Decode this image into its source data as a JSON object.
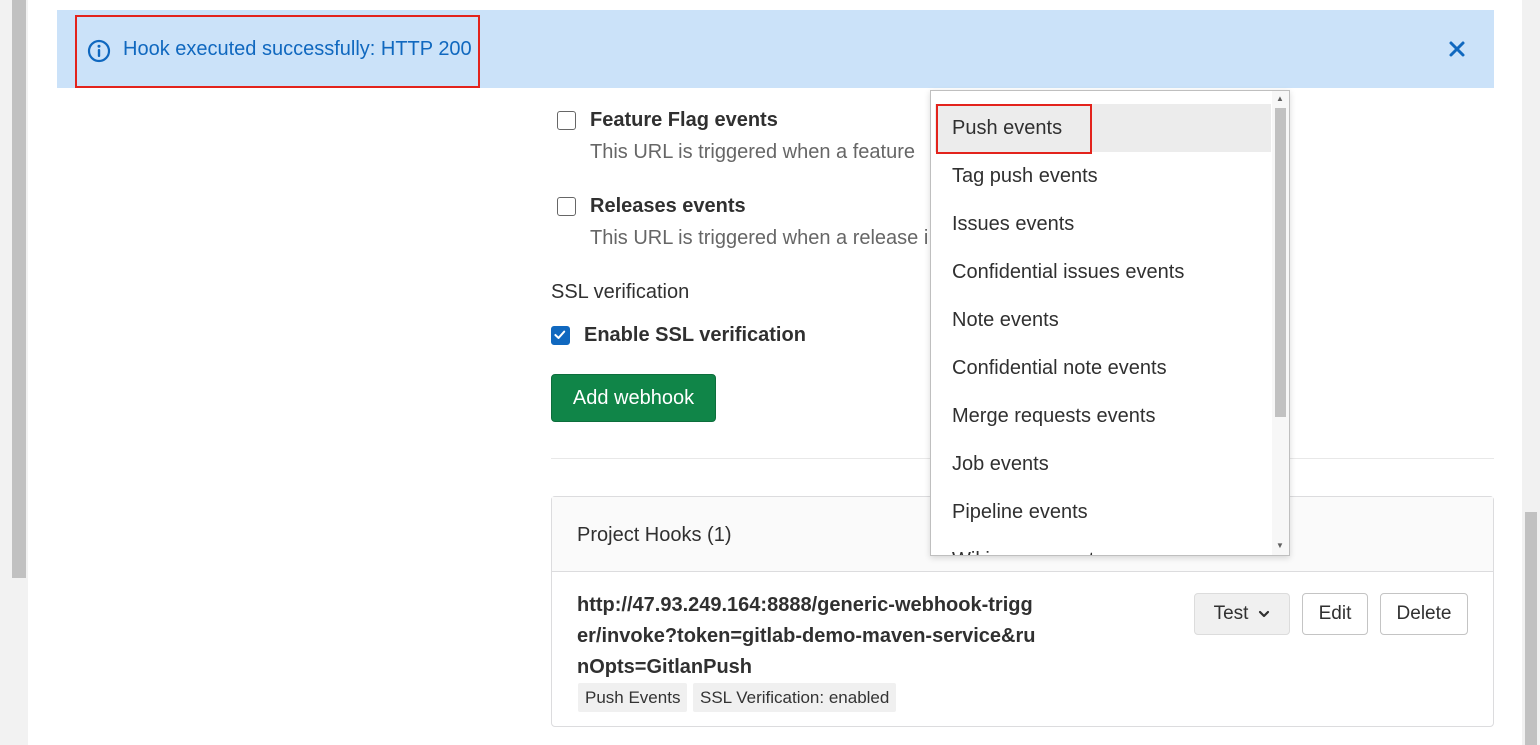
{
  "alert": {
    "message": "Hook executed successfully: HTTP 200",
    "icon": "info-circle-icon",
    "close_icon": "close-icon",
    "bg_color": "#cbe2f9",
    "text_color": "#1068bf"
  },
  "form": {
    "feature_flag": {
      "label": "Feature Flag events",
      "help": "This URL is triggered when a feature",
      "checked": false
    },
    "releases": {
      "label": "Releases events",
      "help": "This URL is triggered when a release i",
      "checked": false
    },
    "ssl_section_label": "SSL verification",
    "ssl": {
      "label": "Enable SSL verification",
      "checked": true
    },
    "submit_label": "Add webhook",
    "submit_color": "#108548"
  },
  "project_hooks": {
    "title": "Project Hooks (1)",
    "hooks": [
      {
        "url": "http://47.93.249.164:8888/generic-webhook-trigger/invoke?token=gitlab-demo-maven-service&runOpts=GitlanPush",
        "tags": [
          "Push Events",
          "SSL Verification: enabled"
        ]
      }
    ],
    "test_label": "Test",
    "edit_label": "Edit",
    "delete_label": "Delete"
  },
  "dropdown": {
    "selected": "Push events",
    "options": [
      "Push events",
      "Tag push events",
      "Issues events",
      "Confidential issues events",
      "Note events",
      "Confidential note events",
      "Merge requests events",
      "Job events",
      "Pipeline events",
      "Wiki page events"
    ]
  },
  "annotation_color": "#e3231c"
}
